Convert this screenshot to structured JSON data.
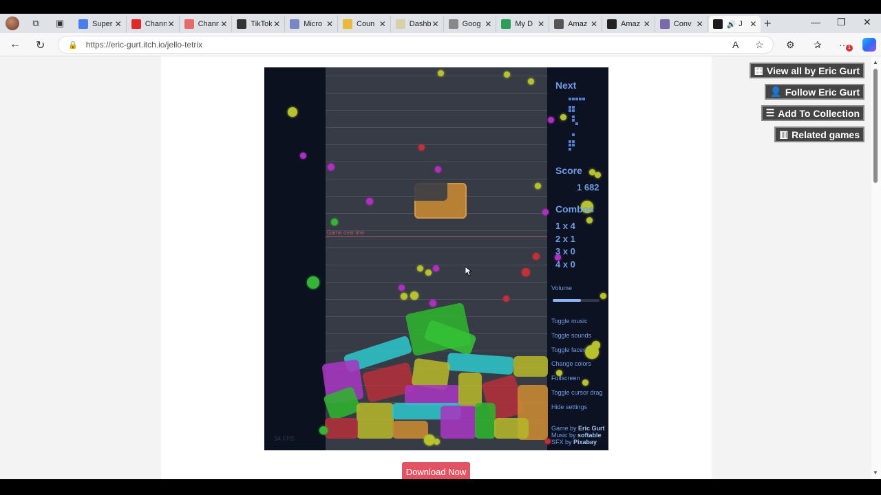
{
  "browser": {
    "tabs": [
      {
        "label": "Super",
        "icon": "docs-icon",
        "color": "#4a7ee8"
      },
      {
        "label": "Chann",
        "icon": "youtube-icon",
        "color": "#e02a2a"
      },
      {
        "label": "Chann",
        "icon": "youtube-studio-icon",
        "color": "#e56a6a"
      },
      {
        "label": "TikTok",
        "icon": "tiktok-icon",
        "color": "#333333"
      },
      {
        "label": "Micro",
        "icon": "microsoft-icon",
        "color": "#7a86c8"
      },
      {
        "label": "Coun",
        "icon": "chrome-web-icon",
        "color": "#e8b93a"
      },
      {
        "label": "Dashb",
        "icon": "dashboard-icon",
        "color": "#d9cfa8"
      },
      {
        "label": "Goog",
        "icon": "google-icon",
        "color": "#888888"
      },
      {
        "label": "My D",
        "icon": "drive-icon",
        "color": "#2d9d57"
      },
      {
        "label": "Amaz",
        "icon": "amazon-icon",
        "color": "#555555"
      },
      {
        "label": "Amaz",
        "icon": "amazon-dark-icon",
        "color": "#222222"
      },
      {
        "label": "Conv",
        "icon": "converter-icon",
        "color": "#7a6aa8"
      },
      {
        "label": "J",
        "icon": "jello-tetrix-icon",
        "color": "#1a1a1a"
      }
    ],
    "new_tab": "+",
    "url": "https://eric-gurt.itch.io/jello-tetrix",
    "notification_count": "1"
  },
  "sidebar_buttons": {
    "view_all": "View all by Eric Gurt",
    "follow": "Follow Eric Gurt",
    "add_collection": "Add To Collection",
    "related": "Related games"
  },
  "game": {
    "next_label": "Next",
    "score_label": "Score",
    "score_value": "1 682",
    "combos_label": "Combos",
    "combos": [
      "1 x 4",
      "2 x 1",
      "3 x 0",
      "4 x 0"
    ],
    "game_over_line": "Game over line",
    "volume_label": "Volume",
    "volume_level": 0.6,
    "settings": [
      "Toggle music",
      "Toggle sounds",
      "Toggle faces",
      "Change colors",
      "Fullscreen",
      "Toggle cursor drag",
      "Hide settings"
    ],
    "credits": [
      {
        "prefix": "Game by ",
        "name": "Eric Gurt"
      },
      {
        "prefix": "Music by ",
        "name": "softable"
      },
      {
        "prefix": "SFX by ",
        "name": "Pixabay"
      }
    ],
    "fps": "34 FPS"
  },
  "download_button": "Download Now"
}
